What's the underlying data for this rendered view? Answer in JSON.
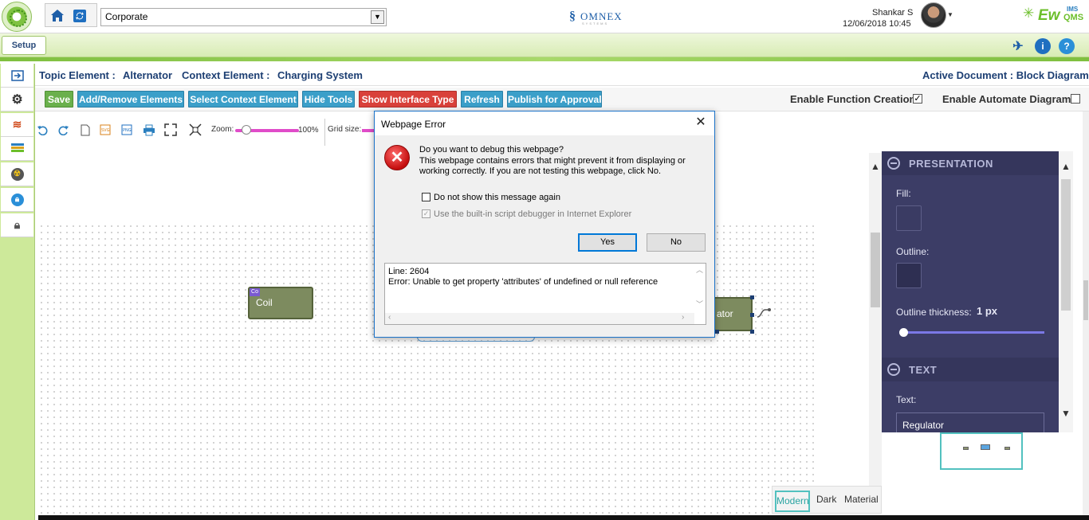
{
  "header": {
    "org_select_value": "Corporate",
    "brand_center": "OMNEX",
    "brand_center_sub": "SYSTEMS",
    "user_name": "Shankar S",
    "datetime": "12/06/2018 10:45",
    "brand_right_ew": "Ew",
    "brand_right_ims": "IMS",
    "brand_right_qms": "QMS"
  },
  "setup": {
    "tab_label": "Setup"
  },
  "breadcrumb": {
    "topic_label": "Topic Element :",
    "topic_value": "Alternator",
    "context_label": "Context Element :",
    "context_value": "Charging System",
    "active_doc": "Active Document : Block Diagram"
  },
  "actions": {
    "save": "Save",
    "add_remove": "Add/Remove Elements",
    "select_context": "Select Context Element",
    "hide_tools": "Hide Tools",
    "show_interface": "Show Interface Type",
    "refresh": "Refresh",
    "publish": "Publish for Approval",
    "enable_function": "Enable Function Creation",
    "enable_function_checked": true,
    "enable_automate": "Enable Automate Diagram",
    "enable_automate_checked": false
  },
  "toolbar": {
    "zoom_label": "Zoom:",
    "zoom_value": "100%",
    "zoom_level": 0.17,
    "grid_label": "Grid size:"
  },
  "canvas": {
    "blocks": [
      {
        "label": "Coil",
        "badge": "Co"
      },
      {
        "label": "ator"
      }
    ]
  },
  "panel": {
    "presentation_title": "PRESENTATION",
    "fill_label": "Fill:",
    "outline_label": "Outline:",
    "thickness_label": "Outline thickness:",
    "thickness_value": "1 px",
    "text_title": "TEXT",
    "text_label": "Text:",
    "text_value": "Regulator"
  },
  "themes": {
    "modern": "Modern",
    "dark": "Dark",
    "material": "Material",
    "active": "Modern"
  },
  "dialog": {
    "title": "Webpage Error",
    "question": "Do you want to debug this webpage?",
    "message": "This webpage contains errors that might prevent it from displaying or working correctly. If you are not testing this webpage, click No.",
    "checkbox1": "Do not show this message again",
    "checkbox1_checked": false,
    "checkbox2": "Use the built-in script debugger in Internet Explorer",
    "checkbox2_checked": true,
    "yes": "Yes",
    "no": "No",
    "detail_line1": "Line: 2604",
    "detail_line2": "Error: Unable to get property 'attributes' of undefined or null reference"
  },
  "colors": {
    "accent_green": "#6ab04c",
    "accent_teal": "#3b9fc9",
    "accent_red": "#d9413a",
    "panel_bg": "#3c3d66",
    "block_fill": "#7d8b5f"
  }
}
